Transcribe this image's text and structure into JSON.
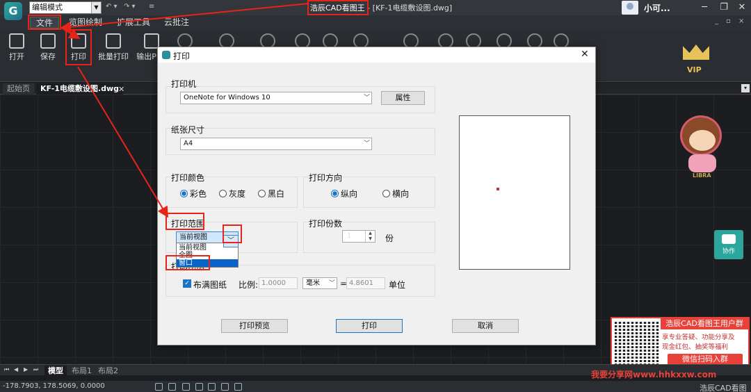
{
  "titlebar": {
    "mode_select": "编辑模式",
    "app_name": "浩辰CAD看图王",
    "file_suffix": " - [KF-1电缆敷设图.dwg]",
    "username": "小可...",
    "min": "─",
    "restore": "❐",
    "close": "✕"
  },
  "menu": {
    "file": "文件",
    "view_draw": "览图绘制",
    "ext_tools": "扩展工具",
    "cloud_note": "云批注",
    "mdi_min": "_",
    "mdi_restore": "▫",
    "mdi_close": "×"
  },
  "toolbar": {
    "open": "打开",
    "save": "保存",
    "print": "打印",
    "batch_print": "批量打印",
    "export_pdf": "输出PDF",
    "vip": "VIP"
  },
  "tabs": {
    "start": "起始页",
    "drawing": "KF-1电缆敷设图.dwg",
    "close": "✕",
    "menu": "▾"
  },
  "layouts": {
    "first": "⏮",
    "prev": "◀",
    "next": "▶",
    "last": "⏭",
    "model": "模型",
    "layout1": "布局1",
    "layout2": "布局2"
  },
  "status": {
    "coords": "-178.7903, 178.5069, 0.0000",
    "brand": "浩辰CAD看图王"
  },
  "dialog": {
    "title": "打印",
    "close": "✕",
    "printer_group": "打印机",
    "printer": "OneNote for Windows 10",
    "properties": "属性",
    "paper_group": "纸张尺寸",
    "paper": "A4",
    "color_group": "打印颜色",
    "color_options": [
      "彩色",
      "灰度",
      "黑白"
    ],
    "orientation_group": "打印方向",
    "orientation_options": [
      "纵向",
      "横向"
    ],
    "range_group": "打印范围",
    "range_value": "当前视图",
    "range_options": [
      "当前视图",
      "全图",
      "窗口"
    ],
    "copies_group": "打印份数",
    "copies": "1",
    "copies_unit": "份",
    "scale_group": "打印比例",
    "fit_paper": "布满图纸",
    "scale_label": "比例:",
    "scale_value": "1.0000",
    "unit_mm": "毫米",
    "equals": "=",
    "drawing_units": "4.8601",
    "unit_label": "单位",
    "preview_btn": "打印预览",
    "print_btn": "打印",
    "cancel_btn": "取消"
  },
  "side": {
    "collab": "协作",
    "mascot_label": "LIBRA"
  },
  "promo": {
    "title": "浩辰CAD看图王用户群",
    "desc1": "享专业答疑、功能分享及",
    "desc2": "现金红包、抽奖等福利",
    "button": "微信扫码入群"
  },
  "watermark": "我要分享网www.hhkxxw.com",
  "colors": {
    "accent": "#1a73c6",
    "annotation_red": "#e82418",
    "app_teal": "#2aa69c"
  }
}
